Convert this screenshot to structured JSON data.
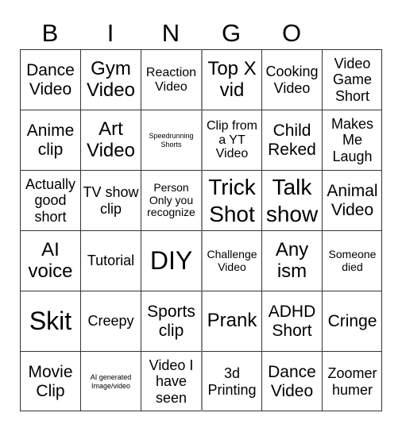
{
  "header": [
    "B",
    "I",
    "N",
    "G",
    "O"
  ],
  "cells": [
    {
      "text": "Dance Video",
      "size": "s5"
    },
    {
      "text": "Gym Video",
      "size": "s6"
    },
    {
      "text": "Reaction Video",
      "size": "s3"
    },
    {
      "text": "Top X vid",
      "size": "s6"
    },
    {
      "text": "Cooking Video",
      "size": "s4"
    },
    {
      "text": "Video Game Short",
      "size": "s4"
    },
    {
      "text": "Anime clip",
      "size": "s5"
    },
    {
      "text": "Art Video",
      "size": "s6"
    },
    {
      "text": "Speedrunning Shorts",
      "size": "s1"
    },
    {
      "text": "Clip from a YT Video",
      "size": "s3"
    },
    {
      "text": "Child Reked",
      "size": "s5"
    },
    {
      "text": "Makes Me Laugh",
      "size": "s4"
    },
    {
      "text": "Actually good short",
      "size": "s4"
    },
    {
      "text": "TV show clip",
      "size": "s4"
    },
    {
      "text": "Person Only you recognize",
      "size": "s2"
    },
    {
      "text": "Trick Shot",
      "size": "s7"
    },
    {
      "text": "Talk show",
      "size": "s7"
    },
    {
      "text": "Animal Video",
      "size": "s5"
    },
    {
      "text": "AI voice",
      "size": "s6"
    },
    {
      "text": "Tutorial",
      "size": "s4"
    },
    {
      "text": "DIY",
      "size": "s8"
    },
    {
      "text": "Challenge Video",
      "size": "s2"
    },
    {
      "text": "Any ism",
      "size": "s6"
    },
    {
      "text": "Someone died",
      "size": "s2"
    },
    {
      "text": "Skit",
      "size": "s8"
    },
    {
      "text": "Creepy",
      "size": "s4"
    },
    {
      "text": "Sports clip",
      "size": "s5"
    },
    {
      "text": "Prank",
      "size": "s6"
    },
    {
      "text": "ADHD Short",
      "size": "s5"
    },
    {
      "text": "Cringe",
      "size": "s5"
    },
    {
      "text": "Movie Clip",
      "size": "s5"
    },
    {
      "text": "AI generated Image/video",
      "size": "s1"
    },
    {
      "text": "Video I have seen",
      "size": "s4"
    },
    {
      "text": "3d Printing",
      "size": "s4"
    },
    {
      "text": "Dance Video",
      "size": "s5"
    },
    {
      "text": "Zoomer humer",
      "size": "s4"
    }
  ]
}
